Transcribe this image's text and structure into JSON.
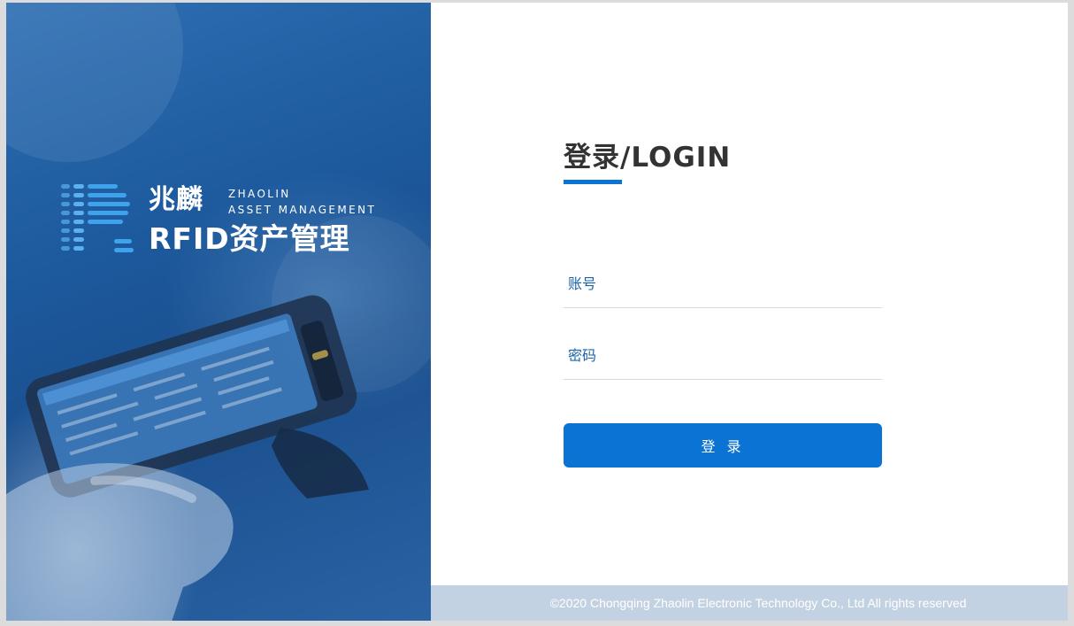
{
  "hero": {
    "logo": {
      "name_cn": "兆麟",
      "name_en_line1": "ZHAOLIN",
      "name_en_line2": "ASSET MANAGEMENT",
      "product_title": "RFID资产管理"
    },
    "image": "rfid-handheld-scanner-photo"
  },
  "login": {
    "heading": "登录/LOGIN",
    "account_placeholder": "账号",
    "password_placeholder": "密码",
    "submit_label": "登 录"
  },
  "footer": {
    "copyright": "©2020 Chongqing Zhaolin Electronic Technology Co., Ltd All rights reserved"
  },
  "colors": {
    "accent": "#0a73d3",
    "hero_blue": "#1d5a9e",
    "footer_bg": "#c3d2e2",
    "heading_text": "#333333",
    "placeholder_text": "#1a64a8"
  }
}
